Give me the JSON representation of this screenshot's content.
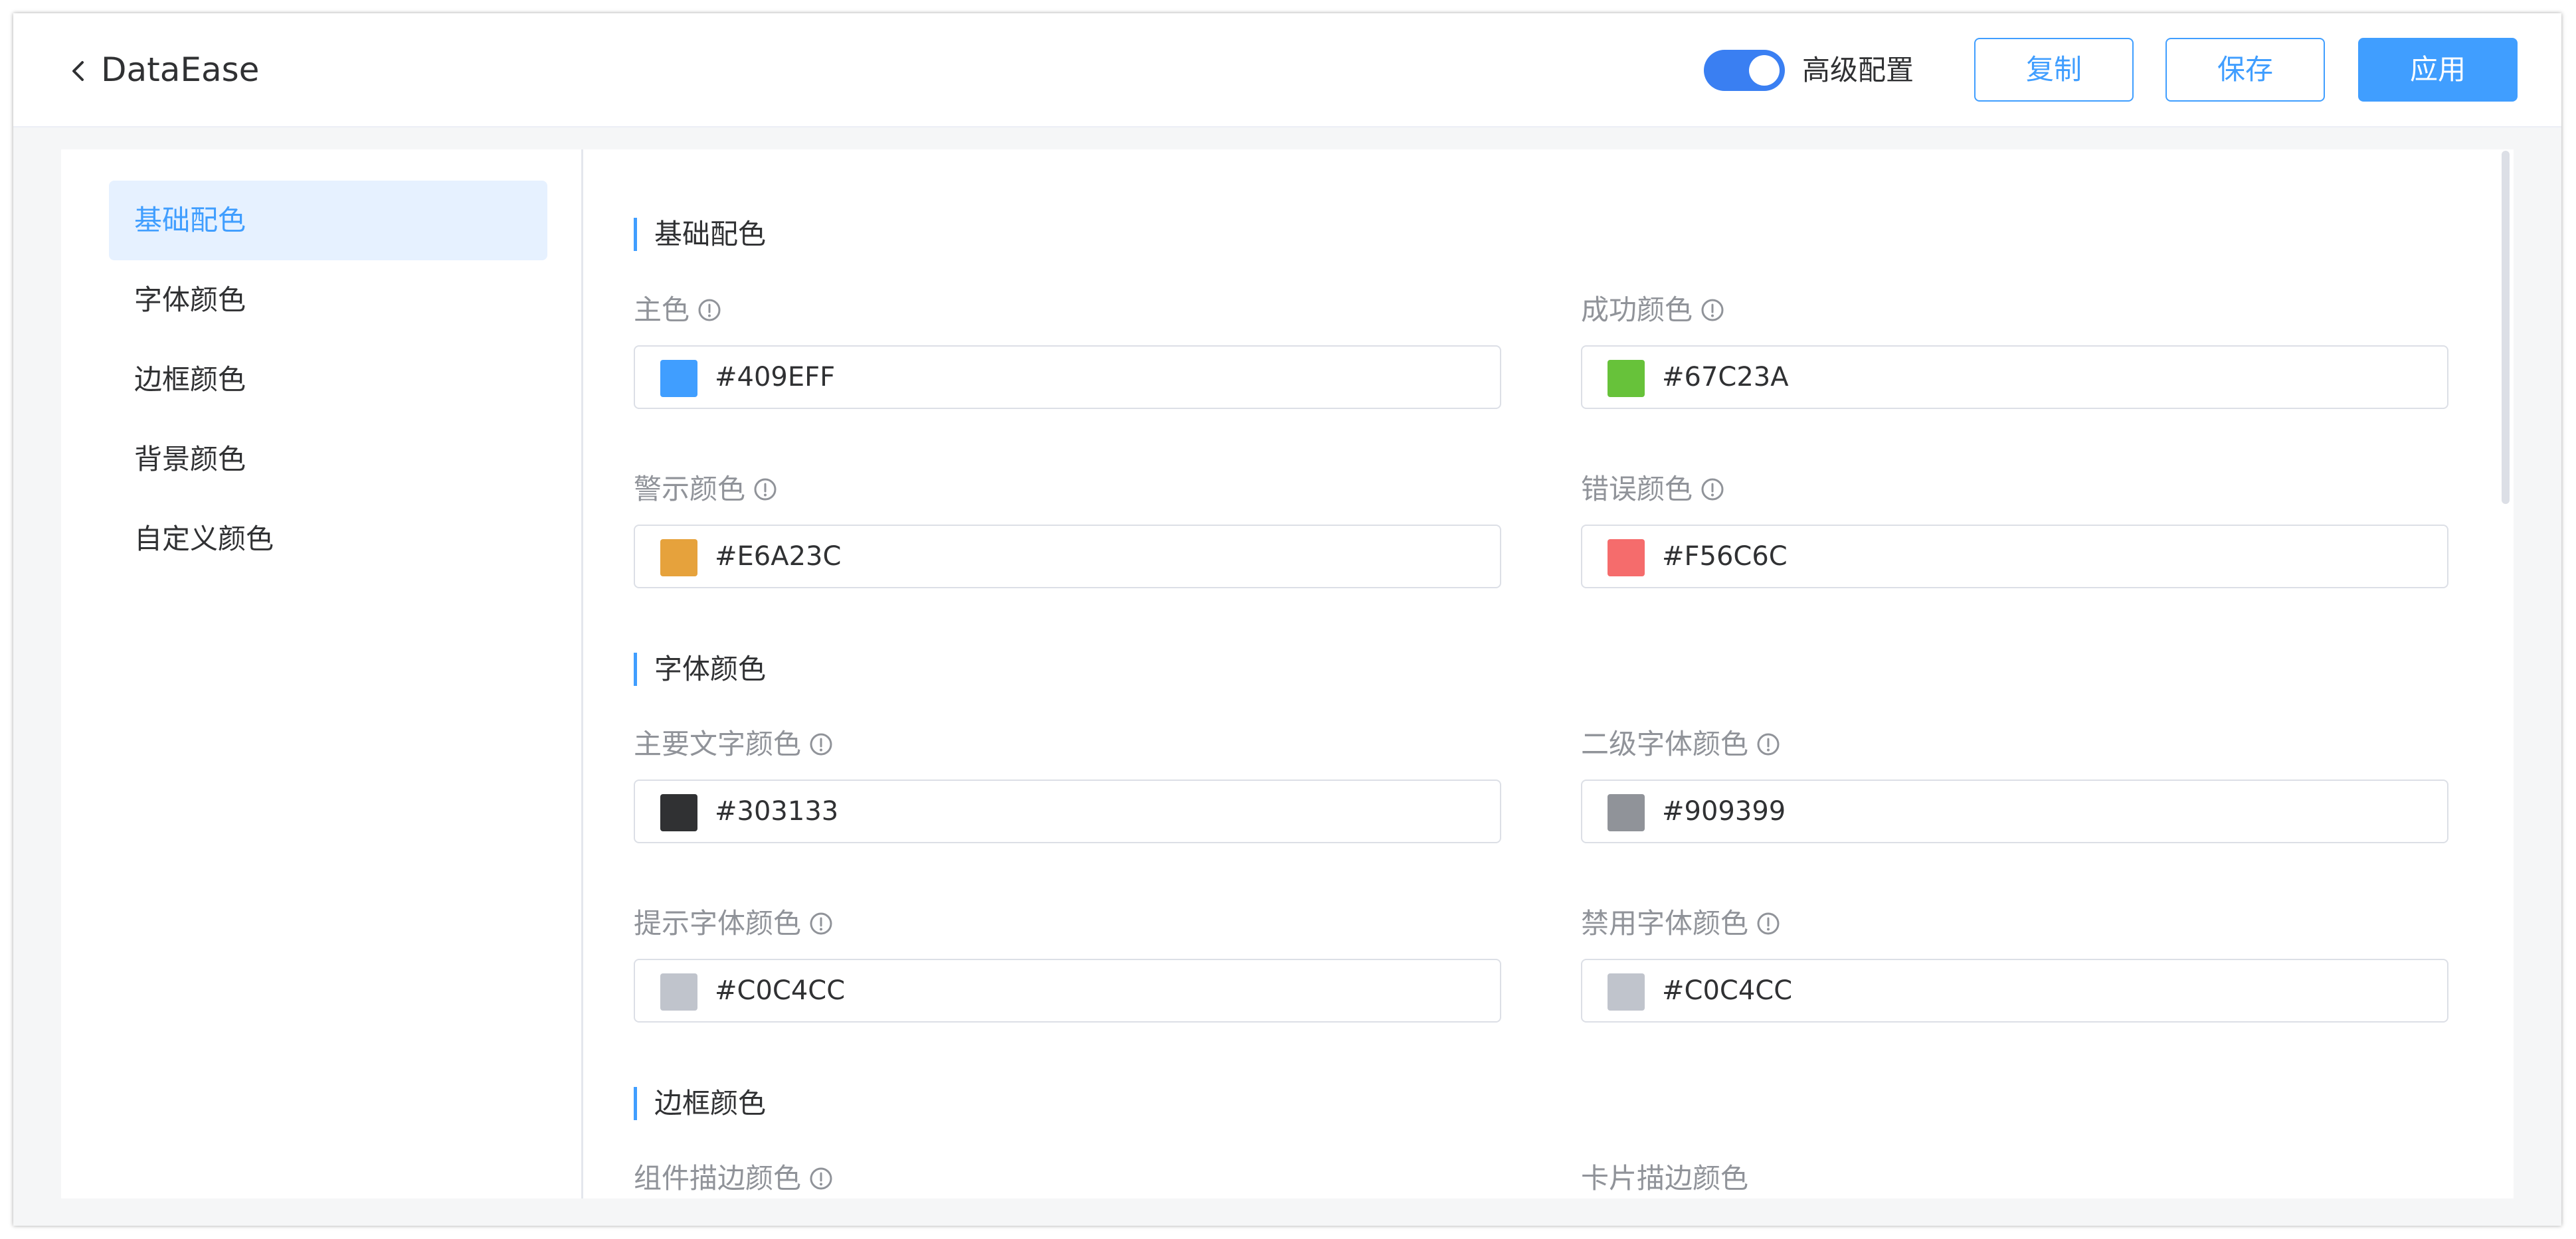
{
  "header": {
    "title": "DataEase",
    "advanced_label": "高级配置",
    "advanced_enabled": true,
    "copy_label": "复制",
    "save_label": "保存",
    "apply_label": "应用"
  },
  "sidebar": {
    "items": [
      {
        "label": "基础配色",
        "active": true
      },
      {
        "label": "字体颜色",
        "active": false
      },
      {
        "label": "边框颜色",
        "active": false
      },
      {
        "label": "背景颜色",
        "active": false
      },
      {
        "label": "自定义颜色",
        "active": false
      }
    ]
  },
  "sections": [
    {
      "title": "基础配色",
      "fields": [
        {
          "label": "主色",
          "value": "#409EFF",
          "color": "#409EFF",
          "info": true
        },
        {
          "label": "成功颜色",
          "value": "#67C23A",
          "color": "#67C23A",
          "info": true
        },
        {
          "label": "警示颜色",
          "value": "#E6A23C",
          "color": "#E6A23C",
          "info": true
        },
        {
          "label": "错误颜色",
          "value": "#F56C6C",
          "color": "#F56C6C",
          "info": true
        }
      ]
    },
    {
      "title": "字体颜色",
      "fields": [
        {
          "label": "主要文字颜色",
          "value": "#303133",
          "color": "#303133",
          "info": true
        },
        {
          "label": "二级字体颜色",
          "value": "#909399",
          "color": "#909399",
          "info": true
        },
        {
          "label": "提示字体颜色",
          "value": "#C0C4CC",
          "color": "#C0C4CC",
          "info": true
        },
        {
          "label": "禁用字体颜色",
          "value": "#C0C4CC",
          "color": "#C0C4CC",
          "info": true
        }
      ]
    },
    {
      "title": "边框颜色",
      "fields": [
        {
          "label": "组件描边颜色",
          "info": true
        },
        {
          "label": "卡片描边颜色",
          "info": false
        }
      ]
    }
  ],
  "colors": {
    "accent": "#409EFF",
    "toggle": "#3A7FF2",
    "active_nav_bg": "#E6F1FF"
  }
}
